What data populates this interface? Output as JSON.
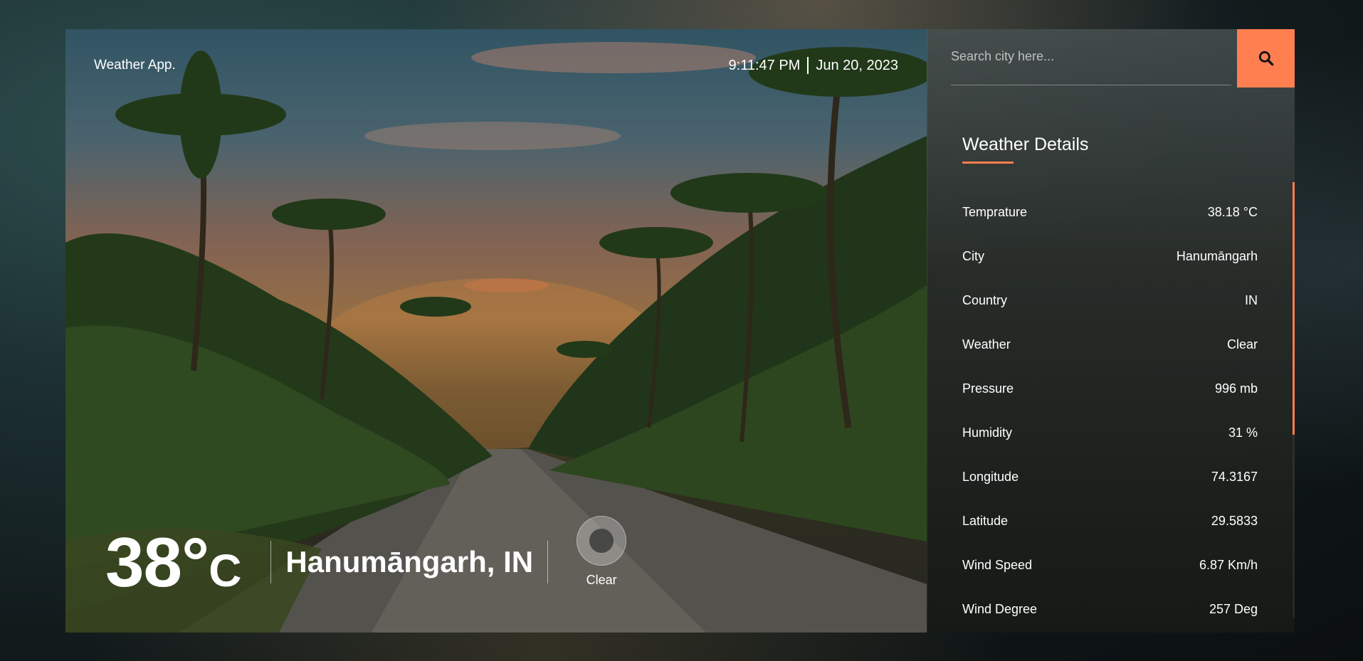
{
  "app": {
    "brand": "Weather App.",
    "time": "9:11:47 PM",
    "date": "Jun 20, 2023"
  },
  "hero": {
    "temp_value": "38°",
    "temp_unit": "C",
    "city": "Hanumāngarh, IN",
    "condition": "Clear",
    "condition_icon": "clear-weather-icon"
  },
  "search": {
    "placeholder": "Search city here...",
    "button_icon": "search-icon"
  },
  "details": {
    "title": "Weather Details",
    "rows": [
      {
        "label": "Temprature",
        "value": "38.18 °C"
      },
      {
        "label": "City",
        "value": "Hanumāngarh"
      },
      {
        "label": "Country",
        "value": "IN"
      },
      {
        "label": "Weather",
        "value": "Clear"
      },
      {
        "label": "Pressure",
        "value": "996 mb"
      },
      {
        "label": "Humidity",
        "value": "31 %"
      },
      {
        "label": "Longitude",
        "value": "74.3167"
      },
      {
        "label": "Latitude",
        "value": "29.5833"
      },
      {
        "label": "Wind Speed",
        "value": "6.87 Km/h"
      },
      {
        "label": "Wind Degree",
        "value": "257 Deg"
      }
    ]
  },
  "colors": {
    "accent": "#ff7f50"
  }
}
